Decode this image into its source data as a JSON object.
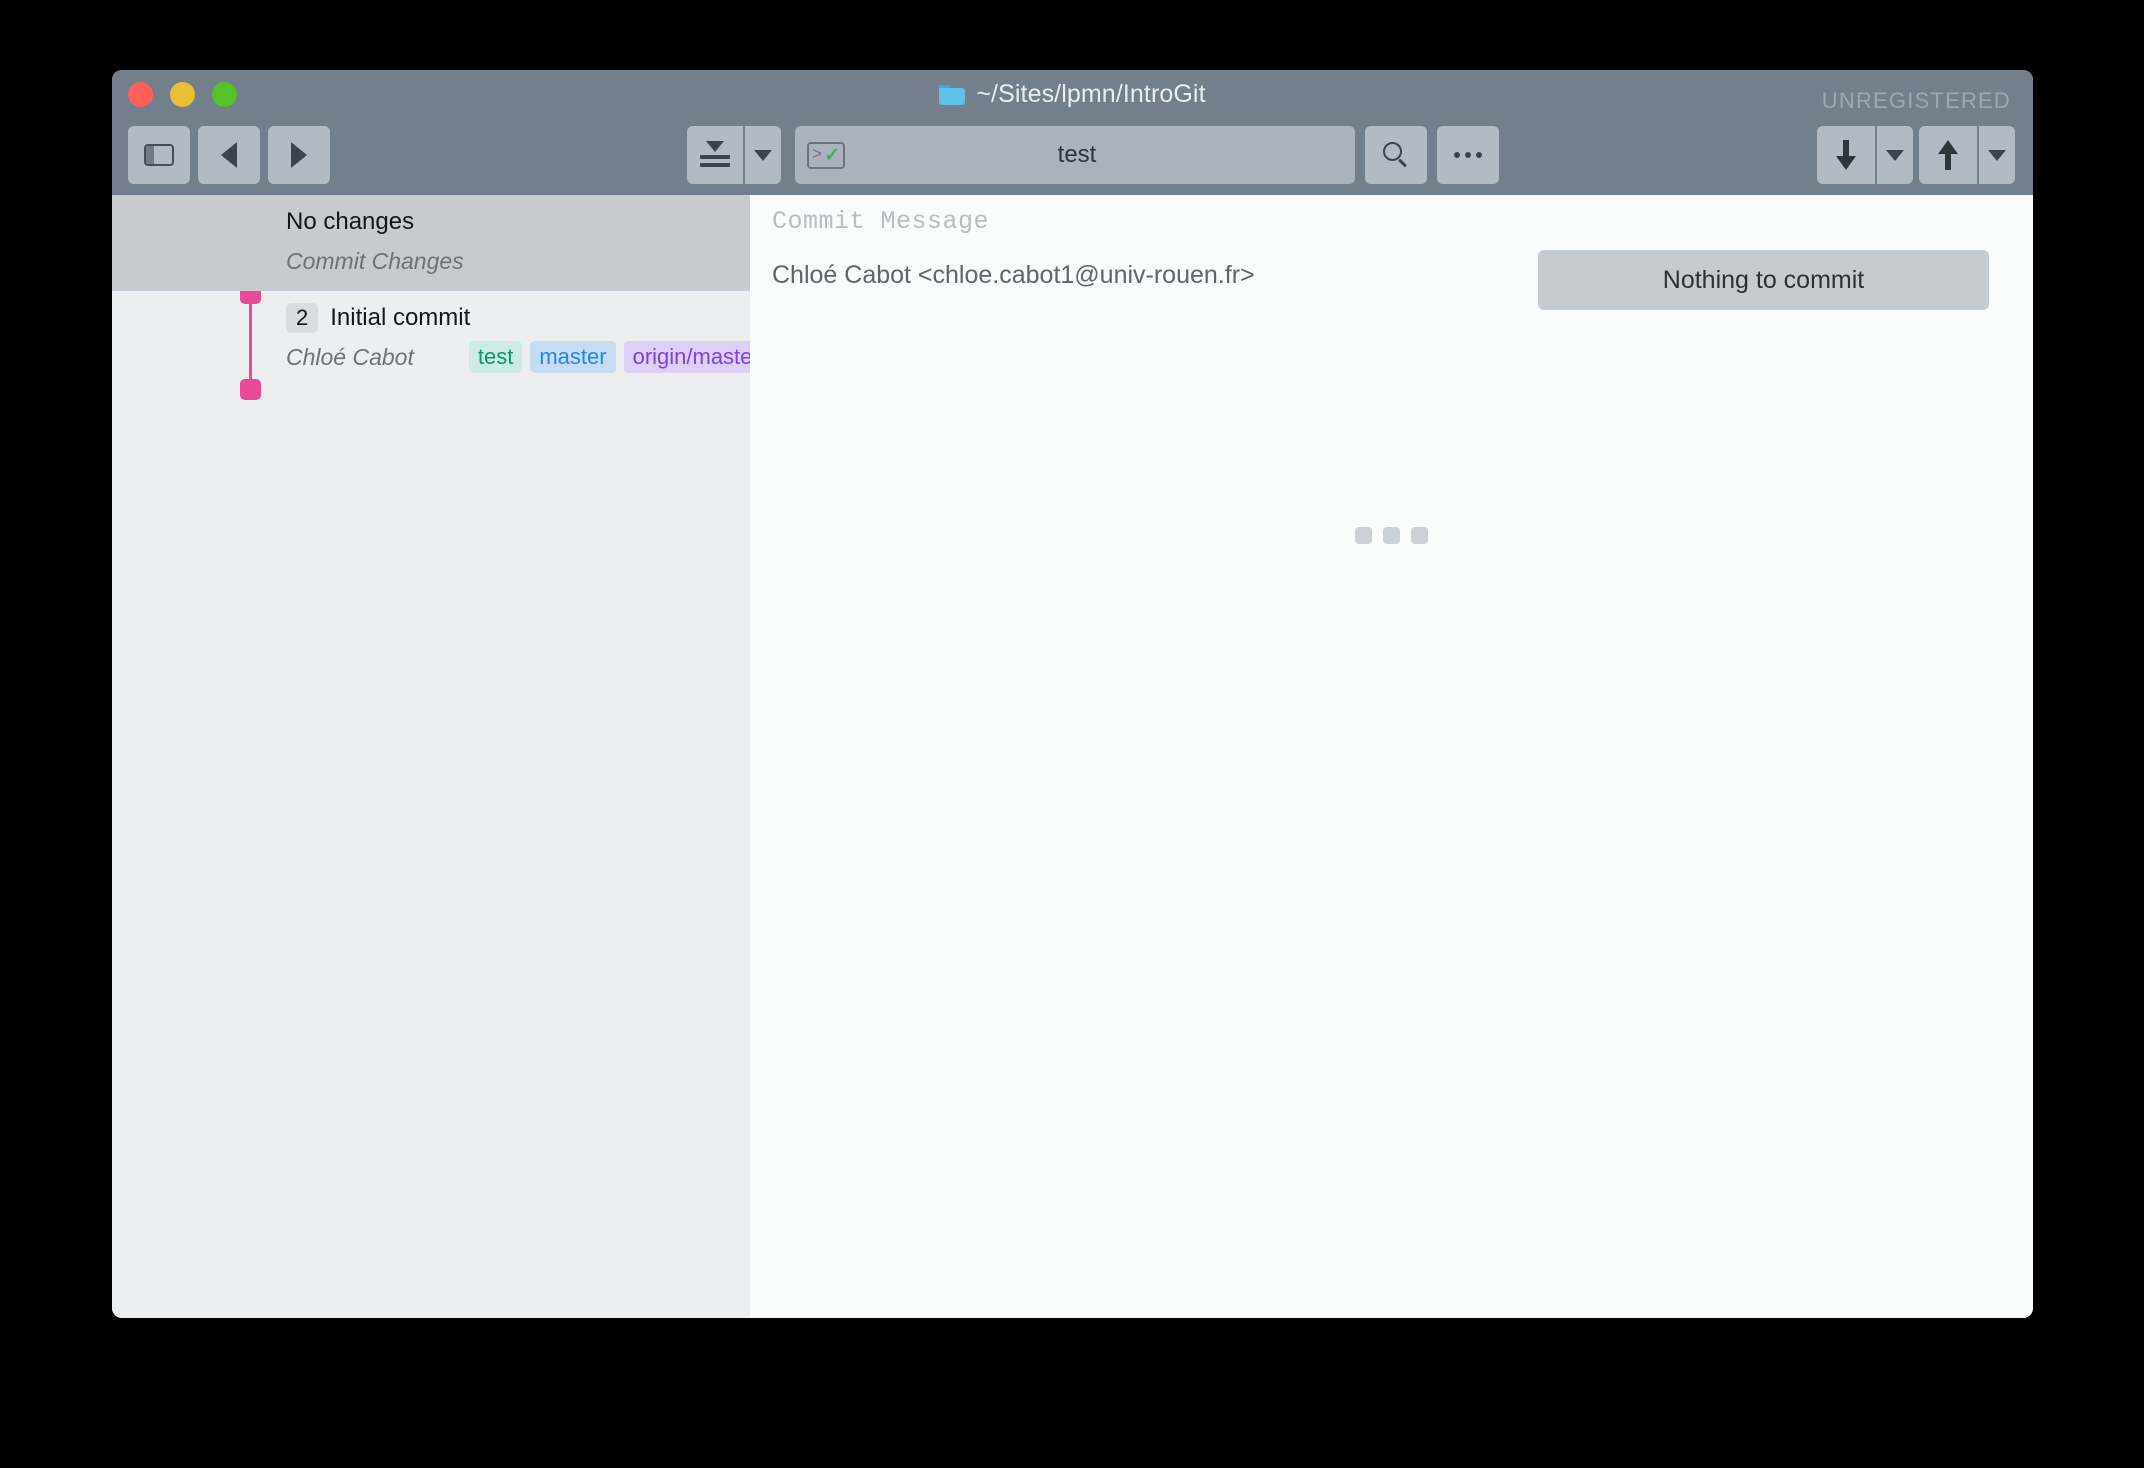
{
  "window": {
    "title": "~/Sites/lpmn/IntroGit",
    "folder_icon": "folder-icon",
    "license_status": "UNREGISTERED",
    "traffic_lights": [
      {
        "name": "close",
        "color": "#ff5f57"
      },
      {
        "name": "minimize",
        "color": "#e8bf35"
      },
      {
        "name": "maximize",
        "color": "#53c22b"
      }
    ]
  },
  "toolbar": {
    "sidebar_toggle": {
      "name": "sidebar-toggle",
      "icon": "sidebar-panel-icon"
    },
    "back": {
      "name": "back",
      "icon": "triangle-left-icon"
    },
    "forward": {
      "name": "forward",
      "icon": "triangle-right-icon"
    },
    "stash": {
      "name": "stash",
      "icon": "stash-icon"
    },
    "stash_menu": {
      "name": "stash-dropdown",
      "icon": "chevron-down-icon"
    },
    "branch_field": {
      "value": "test",
      "terminal_icon": "terminal-check-icon",
      "terminal_prompt": ">",
      "terminal_check": "✓"
    },
    "search": {
      "name": "search",
      "icon": "search-icon"
    },
    "more": {
      "name": "more-options",
      "icon": "ellipsis-icon"
    },
    "pull": {
      "name": "pull",
      "icon": "arrow-down-icon"
    },
    "pull_menu": {
      "name": "pull-dropdown",
      "icon": "chevron-down-icon"
    },
    "push": {
      "name": "push",
      "icon": "arrow-up-icon"
    },
    "push_menu": {
      "name": "push-dropdown",
      "icon": "chevron-down-icon"
    }
  },
  "sidebar": {
    "graph_color": "#ec4899",
    "rows": [
      {
        "title": "No changes",
        "subtitle": "Commit Changes",
        "count": "",
        "selected": true,
        "refs": []
      },
      {
        "title": "Initial commit",
        "subtitle": "Chloé Cabot",
        "count": "2",
        "selected": false,
        "refs": [
          {
            "label": "test",
            "kind": "local",
            "color": "#06946f",
            "bg": "#ccebe3"
          },
          {
            "label": "master",
            "kind": "branch",
            "color": "#2288e0",
            "bg": "#c5dcf2"
          },
          {
            "label": "origin/master",
            "kind": "remote",
            "color": "#7b41e0",
            "bg": "#ded0f5"
          }
        ]
      }
    ]
  },
  "main": {
    "commit_message_placeholder": "Commit Message",
    "commit_author": "Chloé Cabot <chloe.cabot1@univ-rouen.fr>",
    "commit_button_label": "Nothing to commit",
    "splitter_icon": "drag-handle-icon"
  }
}
